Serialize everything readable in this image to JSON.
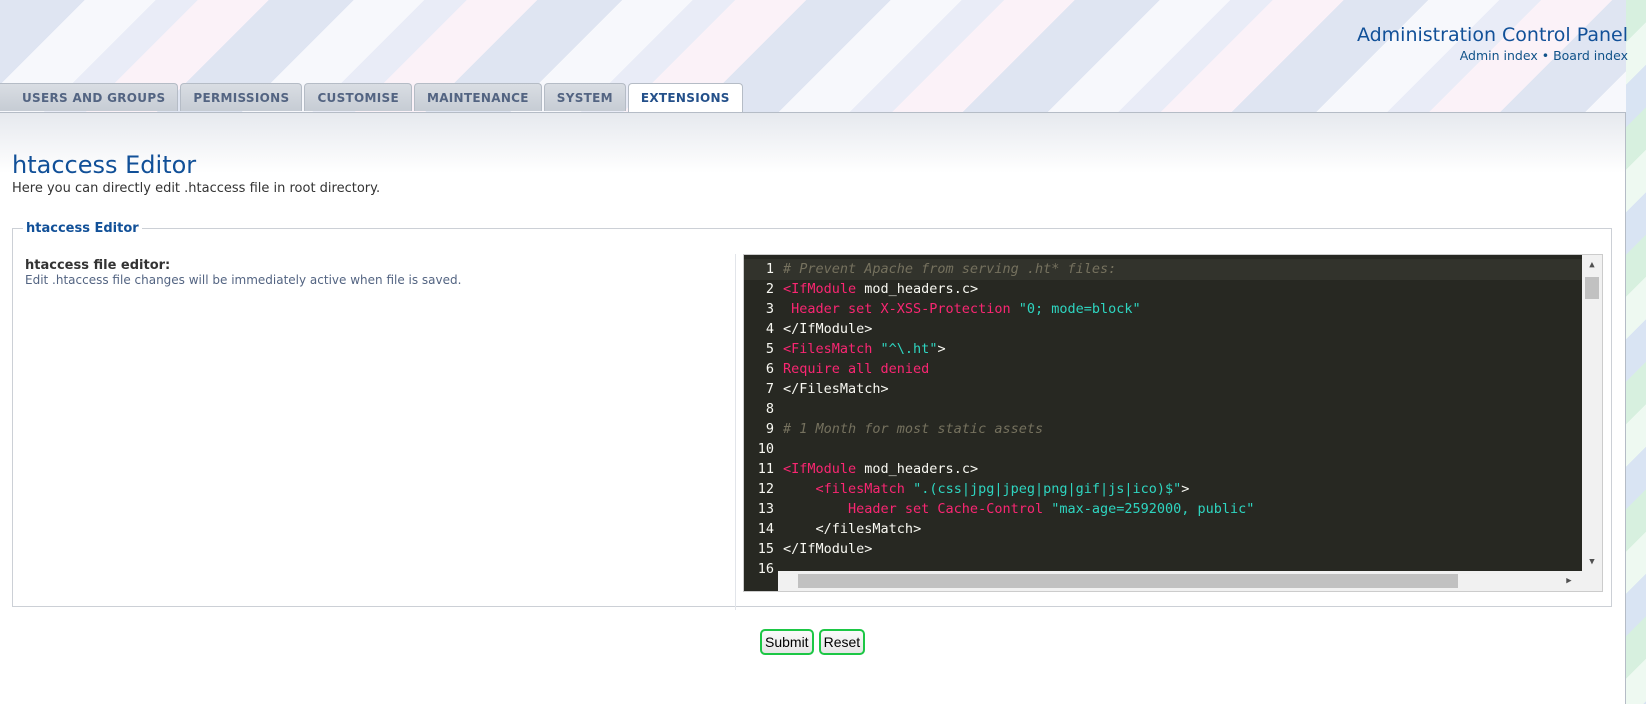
{
  "header": {
    "title": "Administration Control Panel",
    "links": [
      "Admin index",
      "Board index"
    ],
    "separator": "•"
  },
  "tabs": [
    {
      "label": "USERS AND GROUPS",
      "active": false
    },
    {
      "label": "PERMISSIONS",
      "active": false
    },
    {
      "label": "CUSTOMISE",
      "active": false
    },
    {
      "label": "MAINTENANCE",
      "active": false
    },
    {
      "label": "SYSTEM",
      "active": false
    },
    {
      "label": "EXTENSIONS",
      "active": true
    }
  ],
  "page": {
    "title": "htaccess Editor",
    "description": "Here you can directly edit .htaccess file in root directory."
  },
  "fieldset": {
    "legend": "htaccess Editor",
    "label": "htaccess file editor:",
    "explain": "Edit .htaccess file changes will be immediately active when file is saved."
  },
  "editor": {
    "current_line": 1,
    "lines": [
      {
        "n": "1",
        "code": "# Prevent Apache from serving .ht* files:"
      },
      {
        "n": "2",
        "code": "<IfModule mod_headers.c>"
      },
      {
        "n": "3",
        "code": " Header set X-XSS-Protection \"0; mode=block\""
      },
      {
        "n": "4",
        "code": "</IfModule>"
      },
      {
        "n": "5",
        "code": "<FilesMatch \"^\\.ht\">"
      },
      {
        "n": "6",
        "code": "Require all denied"
      },
      {
        "n": "7",
        "code": "</FilesMatch>"
      },
      {
        "n": "8",
        "code": ""
      },
      {
        "n": "9",
        "code": "# 1 Month for most static assets"
      },
      {
        "n": "10",
        "code": ""
      },
      {
        "n": "11",
        "code": "<IfModule mod_headers.c>"
      },
      {
        "n": "12",
        "code": "    <filesMatch \".(css|jpg|jpeg|png|gif|js|ico)$\">"
      },
      {
        "n": "13",
        "code": "        Header set Cache-Control \"max-age=2592000, public\""
      },
      {
        "n": "14",
        "code": "    </filesMatch>"
      },
      {
        "n": "15",
        "code": "</IfModule>"
      },
      {
        "n": "16",
        "code": ""
      }
    ]
  },
  "buttons": {
    "submit": "Submit",
    "reset": "Reset"
  },
  "colors": {
    "accent": "#115098",
    "editor_bg": "#272822",
    "tag": "#f92672",
    "string": "#2ed5c0",
    "comment": "#75715e",
    "button_border": "#1cc745"
  },
  "icons": {
    "scroll_up": "triangle-up-icon",
    "scroll_down": "triangle-down-icon",
    "scroll_right": "triangle-right-icon"
  }
}
